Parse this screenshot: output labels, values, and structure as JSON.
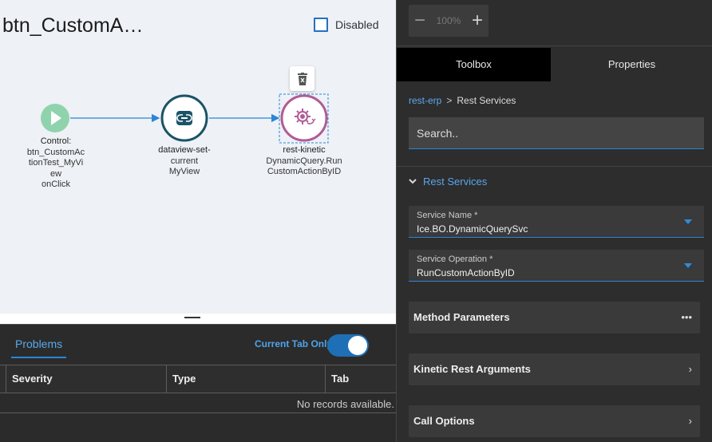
{
  "canvas": {
    "title": "btn_CustomA…",
    "disabled_label": "Disabled",
    "nodes": [
      {
        "name": "Control:",
        "sub": [
          "btn_CustomAc",
          "tionTest_MyVi",
          "ew",
          "onClick"
        ],
        "icon": "play-icon"
      },
      {
        "name": "dataview-set-",
        "sub": [
          "current",
          "MyView"
        ],
        "icon": "link-icon"
      },
      {
        "name": "rest-kinetic",
        "sub": [
          "DynamicQuery.Run",
          "CustomActionByID"
        ],
        "icon": "gear-sync-icon"
      }
    ],
    "delete_icon": "trash-icon"
  },
  "problems": {
    "tab_label": "Problems",
    "current_tab_only_label": "Current Tab Only",
    "current_tab_only": true,
    "columns": [
      "Severity",
      "Type",
      "Tab"
    ],
    "empty_text": "No records available."
  },
  "panel": {
    "zoom": {
      "minus_icon": "minus-icon",
      "value": "100%",
      "plus_icon": "plus-icon"
    },
    "tabs": [
      "Toolbox",
      "Properties"
    ],
    "breadcrumb": {
      "link": "rest-erp",
      "separator": ">",
      "current": "Rest Services"
    },
    "search_placeholder": "Search..",
    "section_title": "Rest Services",
    "service_name": {
      "label": "Service Name *",
      "value": "Ice.BO.DynamicQuerySvc"
    },
    "service_operation": {
      "label": "Service Operation *",
      "value": "RunCustomActionByID"
    },
    "accordions": [
      {
        "label": "Method Parameters",
        "icon": "more-horizontal-icon"
      },
      {
        "label": "Kinetic Rest Arguments",
        "icon": "chevron-right-icon"
      },
      {
        "label": "Call Options",
        "icon": "chevron-right-icon"
      }
    ]
  },
  "colors": {
    "accent": "#2a86d6",
    "start_node": "#8fd3ad",
    "dataview_node": "#1b5367",
    "rest_node": "#b05c95"
  }
}
